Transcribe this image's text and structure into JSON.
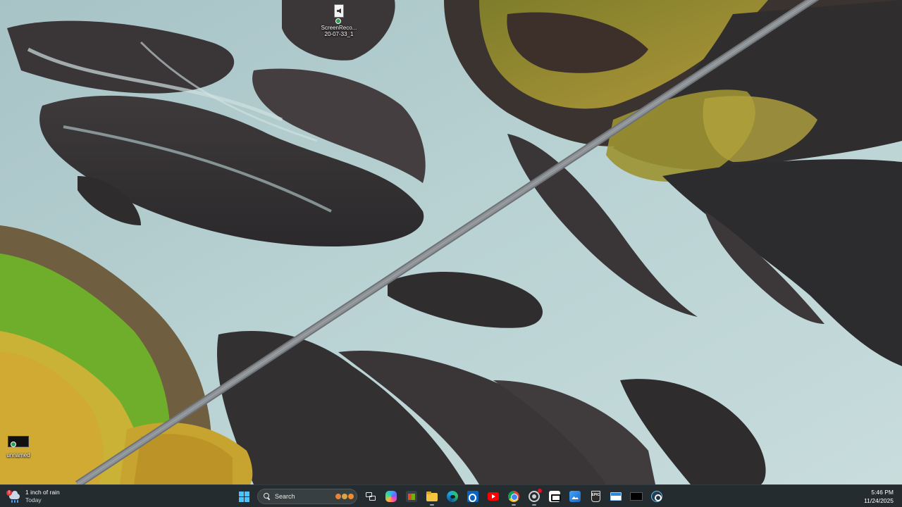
{
  "desktop": {
    "icons": [
      {
        "label_line1": "ScreenReco...",
        "label_line2": "20-07-33_1",
        "icon": "audio-file-icon"
      },
      {
        "label": "unnamed",
        "icon": "image-file-icon"
      }
    ]
  },
  "taskbar": {
    "weather": {
      "title": "1 inch of rain",
      "subtitle": "Today",
      "icon": "rain-cloud-icon",
      "alert": "!"
    },
    "search": {
      "label": "Search"
    },
    "apps": [
      {
        "name": "start",
        "icon": "windows-logo-icon"
      },
      {
        "name": "task-view",
        "icon": "task-view-icon"
      },
      {
        "name": "copilot",
        "icon": "copilot-icon"
      },
      {
        "name": "microsoft-store",
        "icon": "store-icon"
      },
      {
        "name": "file-explorer",
        "icon": "folder-icon"
      },
      {
        "name": "edge",
        "icon": "edge-icon"
      },
      {
        "name": "outlook",
        "icon": "outlook-icon"
      },
      {
        "name": "youtube",
        "icon": "youtube-icon"
      },
      {
        "name": "chrome",
        "icon": "chrome-icon"
      },
      {
        "name": "screen-recorder",
        "icon": "recorder-icon"
      },
      {
        "name": "capcut",
        "icon": "capcut-icon"
      },
      {
        "name": "photos",
        "icon": "photos-icon"
      },
      {
        "name": "epic-games",
        "icon": "epic-icon",
        "text": "EPIC"
      },
      {
        "name": "window-app",
        "icon": "window-icon"
      },
      {
        "name": "black-app",
        "icon": "black-app-icon"
      },
      {
        "name": "steam",
        "icon": "steam-icon"
      }
    ],
    "clock": {
      "time": "5:46 PM",
      "date": "11/24/2025"
    }
  }
}
